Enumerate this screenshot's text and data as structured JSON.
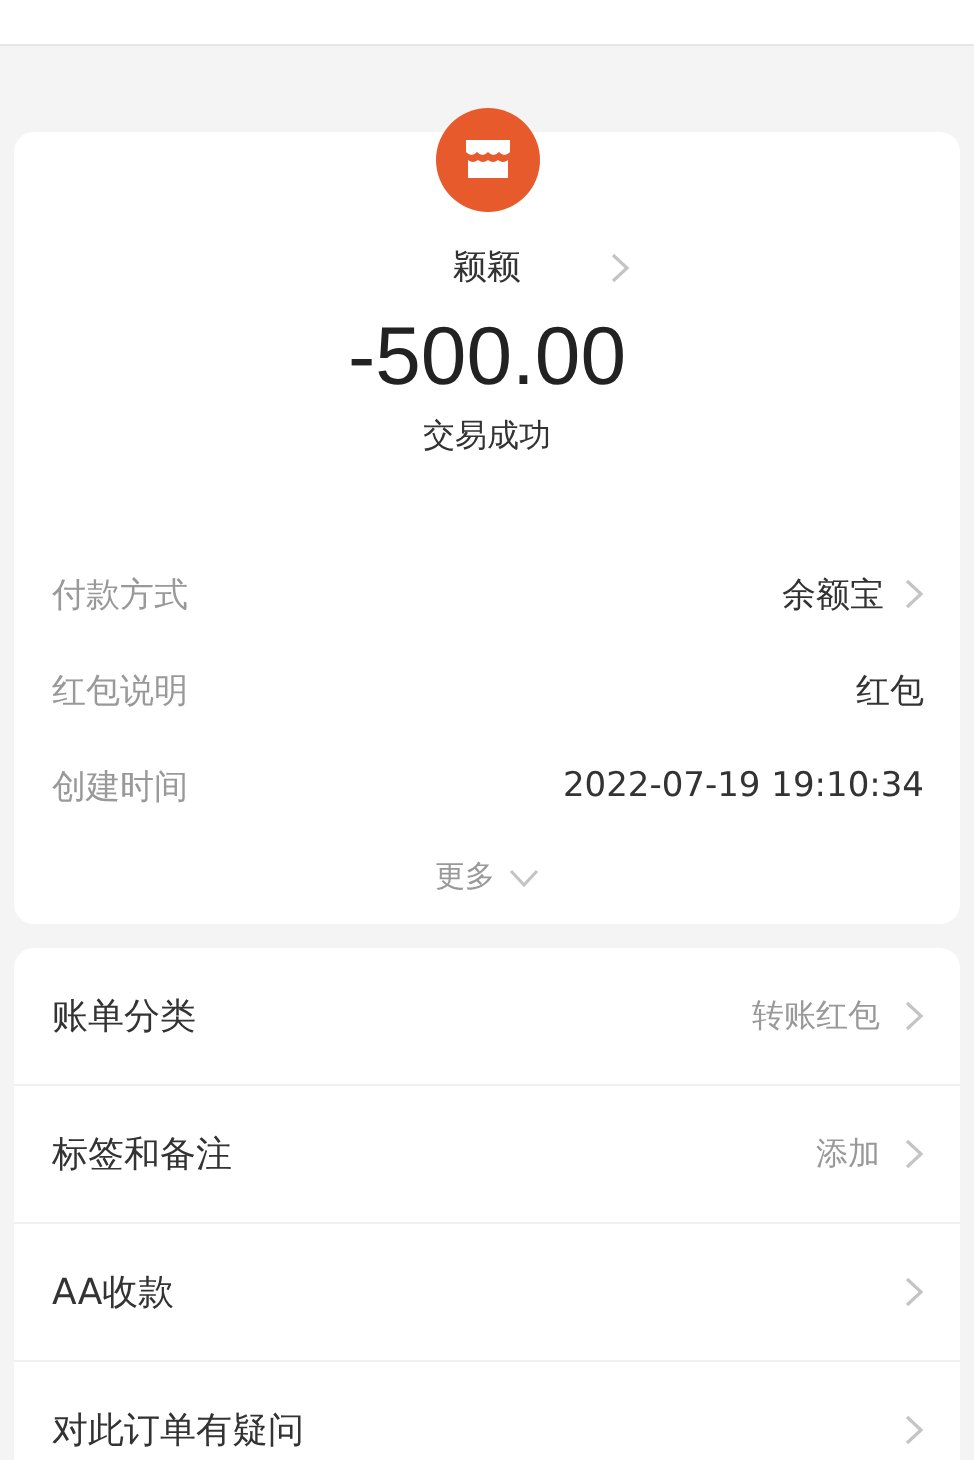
{
  "payee": {
    "name": "颖颖"
  },
  "amount": "-500.00",
  "status": "交易成功",
  "details": [
    {
      "label": "付款方式",
      "value": "余额宝",
      "arrow": true
    },
    {
      "label": "红包说明",
      "value": "红包",
      "arrow": false
    },
    {
      "label": "创建时间",
      "value": "2022-07-19 19:10:34",
      "arrow": false
    }
  ],
  "more": "更多",
  "actions": [
    {
      "label": "账单分类",
      "value": "转账红包"
    },
    {
      "label": "标签和备注",
      "value": "添加"
    },
    {
      "label": "AA收款"
    },
    {
      "label": "对此订单有疑问"
    }
  ]
}
